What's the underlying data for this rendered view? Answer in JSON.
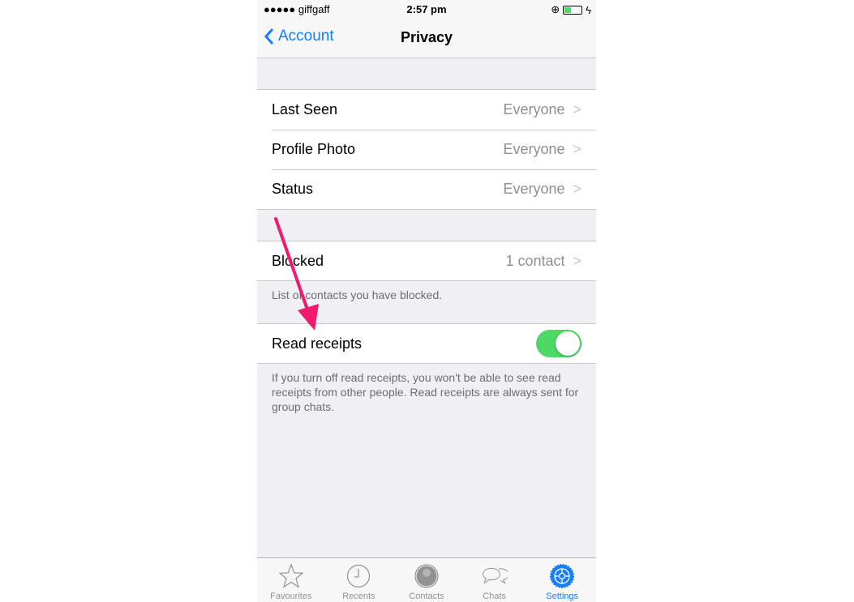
{
  "status_bar": {
    "carrier": "●●●●● giffgaff",
    "time": "2:57 pm"
  },
  "nav": {
    "back_label": "Account",
    "title": "Privacy"
  },
  "privacy_rows": [
    {
      "label": "Last Seen",
      "value": "Everyone"
    },
    {
      "label": "Profile Photo",
      "value": "Everyone"
    },
    {
      "label": "Status",
      "value": "Everyone"
    }
  ],
  "blocked": {
    "label": "Blocked",
    "value": "1 contact",
    "footer": "List of contacts you have blocked."
  },
  "read_receipts": {
    "label": "Read receipts",
    "enabled": true,
    "footer": "If you turn off read receipts, you won't be able to see read receipts from other people. Read receipts are always sent for group chats."
  },
  "tabs": [
    {
      "label": "Favourites",
      "icon": "star-icon"
    },
    {
      "label": "Recents",
      "icon": "clock-icon"
    },
    {
      "label": "Contacts",
      "icon": "contact-icon"
    },
    {
      "label": "Chats",
      "icon": "chat-bubbles-icon"
    },
    {
      "label": "Settings",
      "icon": "gear-icon",
      "active": true
    }
  ],
  "colors": {
    "accent": "#157efb",
    "toggle_on": "#4cd964",
    "annotation_arrow": "#f0196e"
  }
}
